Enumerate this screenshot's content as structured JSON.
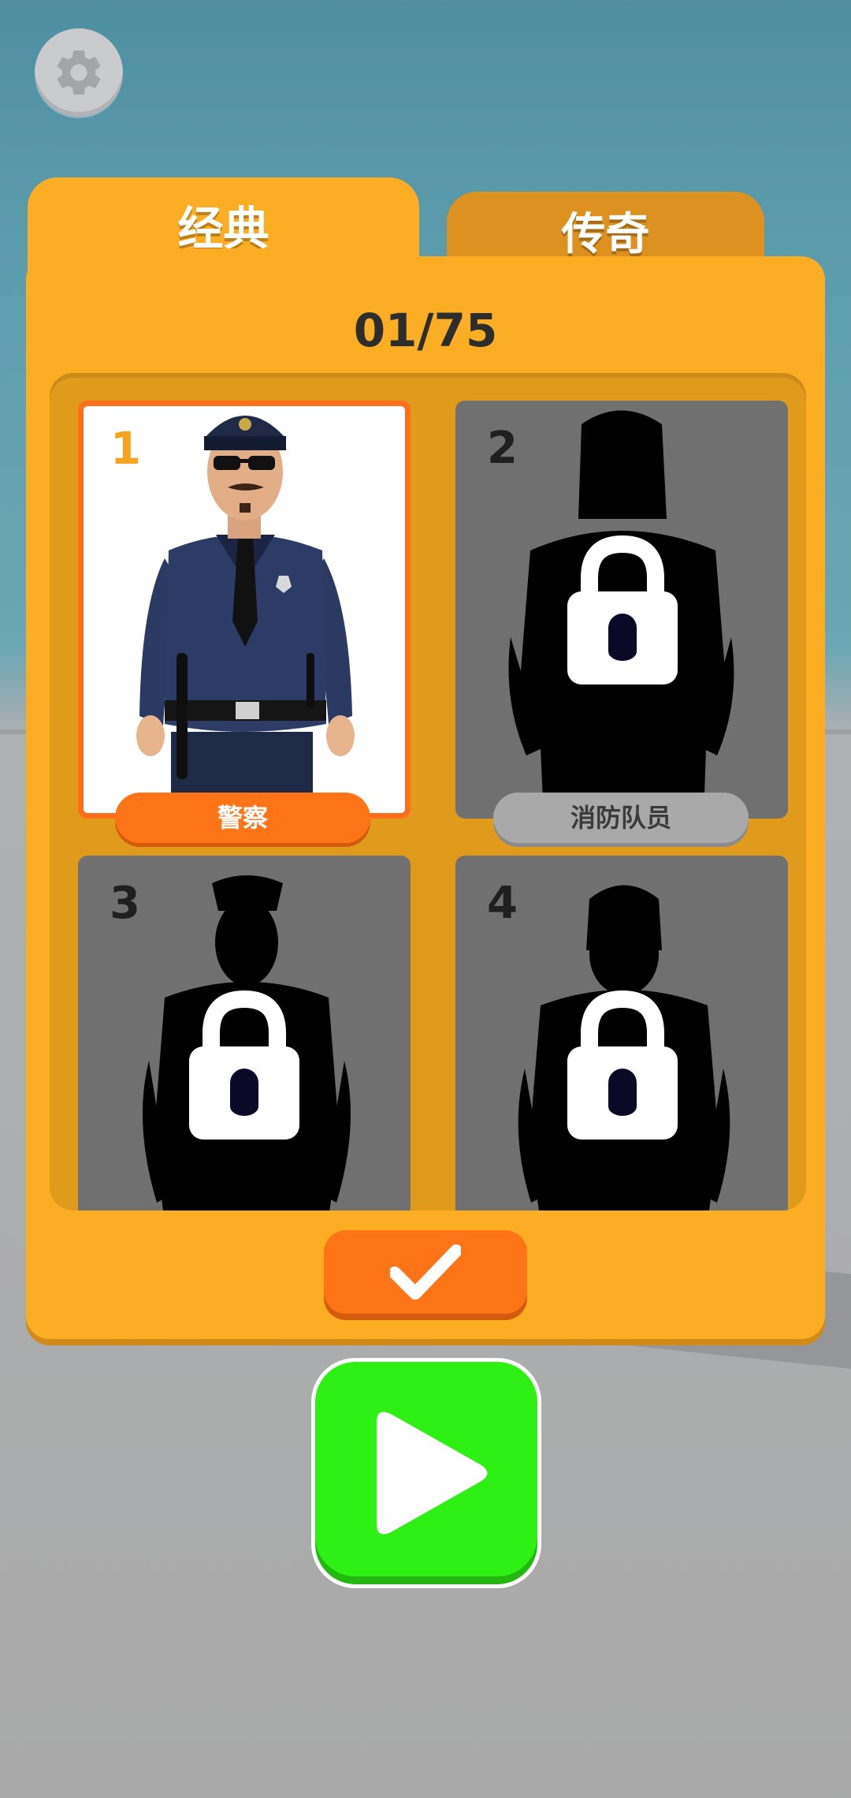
{
  "settings": {
    "icon": "gear-icon"
  },
  "tabs": [
    {
      "label": "经典",
      "active": true
    },
    {
      "label": "传奇",
      "active": false
    }
  ],
  "collection": {
    "counter": "01/75"
  },
  "cards": [
    {
      "number": "1",
      "name": "警察",
      "locked": false,
      "selected": true
    },
    {
      "number": "2",
      "name": "消防队员",
      "locked": true,
      "selected": false
    },
    {
      "number": "3",
      "locked": true,
      "selected": false
    },
    {
      "number": "4",
      "locked": true,
      "selected": false
    }
  ],
  "buttons": {
    "confirm_icon": "checkmark-icon",
    "play_icon": "play-icon"
  },
  "colors": {
    "panel": "#fbad24",
    "accent": "#ff7417",
    "play": "#2ef015",
    "locked_card": "#707070"
  }
}
